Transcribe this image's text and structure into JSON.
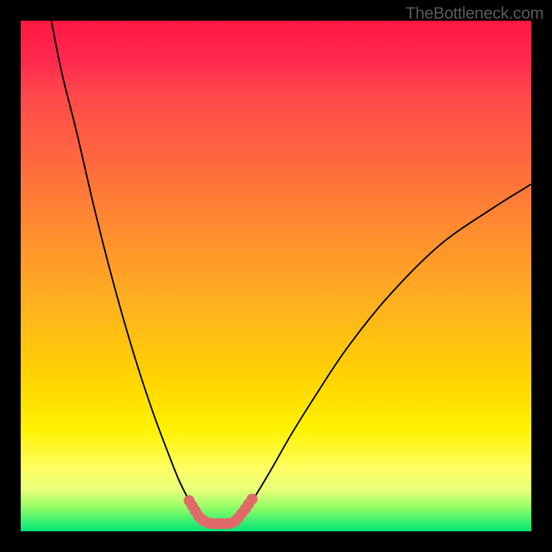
{
  "watermark": "TheBottleneck.com",
  "chart_data": {
    "type": "line",
    "title": "",
    "xlabel": "",
    "ylabel": "",
    "xlim": [
      0,
      100
    ],
    "ylim": [
      0,
      100
    ],
    "series": [
      {
        "name": "curve-left",
        "x": [
          6,
          8,
          11,
          14,
          17,
          20,
          23,
          26,
          29,
          31,
          33,
          34.5,
          36
        ],
        "y": [
          100,
          90,
          78,
          65,
          53,
          42,
          32,
          23,
          15,
          10,
          6,
          3.5,
          2
        ]
      },
      {
        "name": "curve-right",
        "x": [
          42,
          44,
          46,
          49,
          53,
          58,
          64,
          72,
          82,
          92,
          100
        ],
        "y": [
          2,
          4,
          7,
          12,
          19,
          27,
          36,
          46,
          56,
          63,
          68
        ]
      }
    ],
    "annotations": {
      "marker_points_left": [
        [
          33,
          6
        ],
        [
          33.6,
          5
        ],
        [
          34.2,
          4
        ],
        [
          34.8,
          3
        ],
        [
          35.5,
          2.3
        ],
        [
          36,
          2
        ]
      ],
      "marker_points_right": [
        [
          42,
          2
        ],
        [
          42.6,
          2.6
        ],
        [
          43.3,
          3.5
        ],
        [
          44,
          4.4
        ],
        [
          44.6,
          5.3
        ],
        [
          45.3,
          6.3
        ]
      ],
      "marker_points_flat": [
        [
          36.8,
          1.6
        ],
        [
          37.7,
          1.5
        ],
        [
          38.6,
          1.5
        ],
        [
          39.5,
          1.5
        ],
        [
          40.4,
          1.5
        ],
        [
          41.2,
          1.6
        ]
      ],
      "marker_color": "#e06a6a",
      "marker_radius": 8
    },
    "background_gradient": {
      "top": "#ff1744",
      "mid": "#ffd400",
      "bottom": "#00e676"
    }
  }
}
